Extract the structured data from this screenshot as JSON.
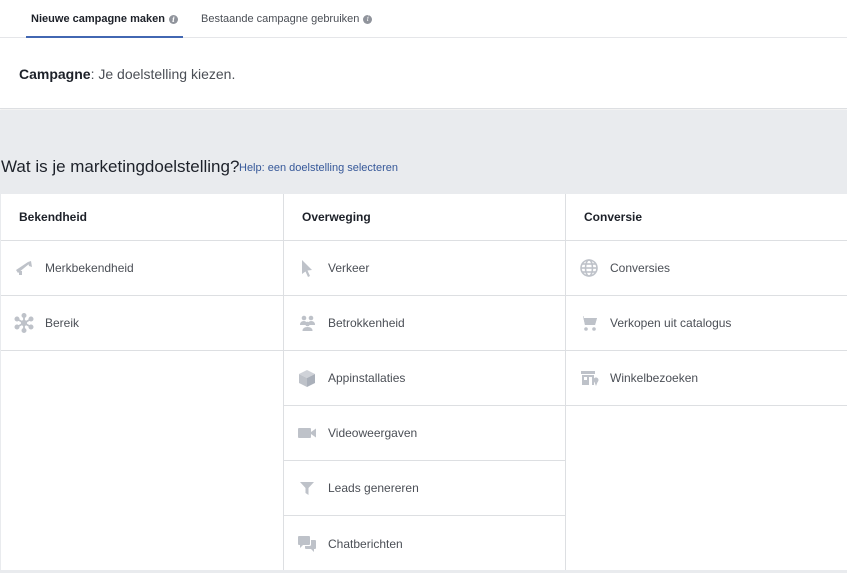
{
  "tabs": {
    "new": "Nieuwe campagne maken",
    "existing": "Bestaande campagne gebruiken",
    "info_glyph": "i"
  },
  "campaign": {
    "label": "Campagne",
    "text": ": Je doelstelling kiezen."
  },
  "objective": {
    "question": "Wat is je marketingdoelstelling?",
    "help_link": "Help: een doelstelling selecteren"
  },
  "columns": [
    {
      "title": "Bekendheid",
      "items": [
        {
          "label": "Merkbekendheid",
          "icon": "megaphone-icon"
        },
        {
          "label": "Bereik",
          "icon": "reach-asterisk-icon"
        }
      ]
    },
    {
      "title": "Overweging",
      "items": [
        {
          "label": "Verkeer",
          "icon": "cursor-icon"
        },
        {
          "label": "Betrokkenheid",
          "icon": "people-icon"
        },
        {
          "label": "Appinstallaties",
          "icon": "box-icon"
        },
        {
          "label": "Videoweergaven",
          "icon": "video-camera-icon"
        },
        {
          "label": "Leads genereren",
          "icon": "funnel-icon"
        },
        {
          "label": "Chatberichten",
          "icon": "chat-bubbles-icon"
        }
      ]
    },
    {
      "title": "Conversie",
      "items": [
        {
          "label": "Conversies",
          "icon": "globe-icon"
        },
        {
          "label": "Verkopen uit catalogus",
          "icon": "cart-icon"
        },
        {
          "label": "Winkelbezoeken",
          "icon": "store-icon"
        }
      ]
    }
  ],
  "colors": {
    "accent": "#4267b2",
    "link": "#365899",
    "icon": "#bec2c9",
    "background": "#e9ebee"
  }
}
